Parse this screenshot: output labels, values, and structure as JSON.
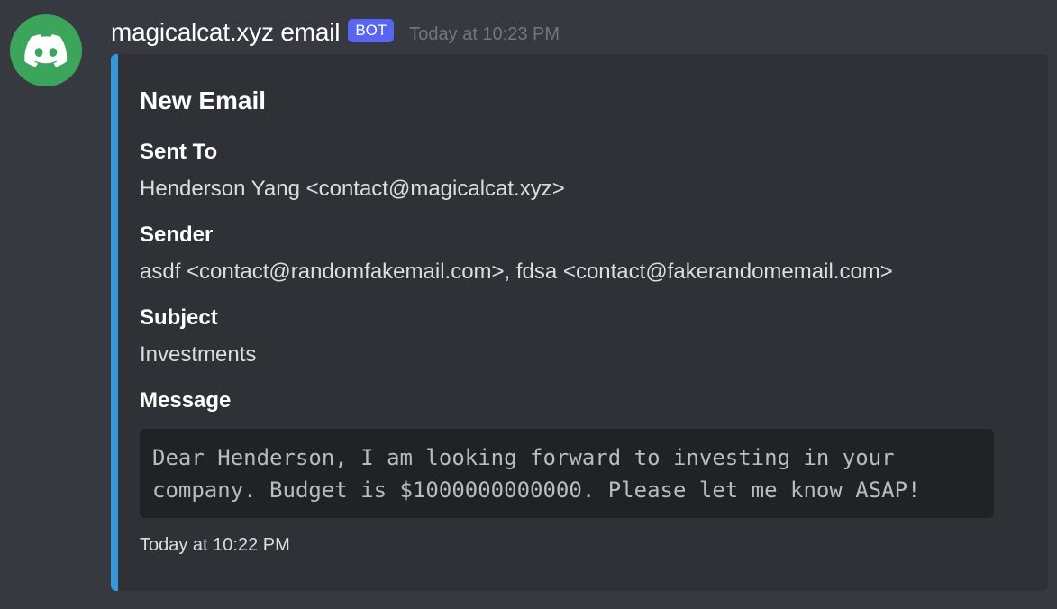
{
  "author": {
    "username": "magicalcat.xyz email",
    "tag": "BOT",
    "timestamp": "Today at 10:23 PM",
    "avatar_icon": "discord-logo-icon",
    "avatar_color": "#3ba55c"
  },
  "embed": {
    "accent_color": "#3498db",
    "title": "New Email",
    "fields": [
      {
        "name": "Sent To",
        "value": "Henderson Yang <contact@magicalcat.xyz>"
      },
      {
        "name": "Sender",
        "value": "asdf <contact@randomfakemail.com>, fdsa <contact@fakerandomemail.com>"
      },
      {
        "name": "Subject",
        "value": "Investments"
      },
      {
        "name": "Message",
        "value": "Dear Henderson, I am looking forward to investing in your company. Budget is $1000000000000. Please let me know ASAP!"
      }
    ],
    "footer": "Today at 10:22 PM"
  }
}
